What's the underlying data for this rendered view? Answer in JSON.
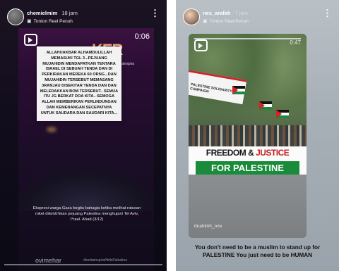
{
  "story1": {
    "username": "chemielmim",
    "time": "18 jam",
    "subtitle": "Tonton Reel Penuh",
    "duration": "0:06",
    "brand": "KER",
    "channel_handle": "beritainspira",
    "message": "ALLAHUAKBAR ALHAMDULILLAH MEMASUKI TGL 3...PEJUANG MUJAHIDIN MENDAPATKAN TENTARA ISRAEL DI SEBUAH TENDA DAN DI PERKIRAKAN MEREKA 60 ORNG...DAN MUJAHIDIN TERSEBUT MEMASANG 3RANJAU DISEKITAR TENDA DAN DAN MELEDAKKAN BOM TERSEBUT.. SEMUA ITU JG BERKAT DOA KITA.. SEMOGA ALLAH MEMBERIKAN PERLINDUNGAN DAN KEMENANGAN SECEPATNYA UNTUK SAUDARA DAN SAUDARI KITA...",
    "caption": "Ekspresi warga Gaza begitu bahagia ketika melihat ratusan roket dilemb'kkan pejuang Palestina menghujani Tel Aviv, I*rael. Ahad (3/12)",
    "watermark": "ovimehar",
    "watermark_small": "#beritainspira/HidsPalestina"
  },
  "story2": {
    "username": "nes_arafah",
    "time": "7 jam",
    "subtitle": "Tonton Reel Penuh",
    "duration": "0:47",
    "sign_text": "PALESTINE SOLIDARITY CAMPAIGN",
    "banner_line1_a": "FREEDOM & ",
    "banner_line1_b": "JUSTICE",
    "banner_line2": "FOR PALESTINE",
    "handle": "ibrahimh_one",
    "caption": "You don't need to be a muslim to stand up for PALESTINE You just need to be HUMAN"
  },
  "icons": [
    "reel-icon",
    "more-icon",
    "clapper-icon"
  ],
  "colors": {
    "brand_orange": "#ffb27a",
    "banner_green": "#1a8b3a",
    "banner_red": "#c31f26"
  }
}
